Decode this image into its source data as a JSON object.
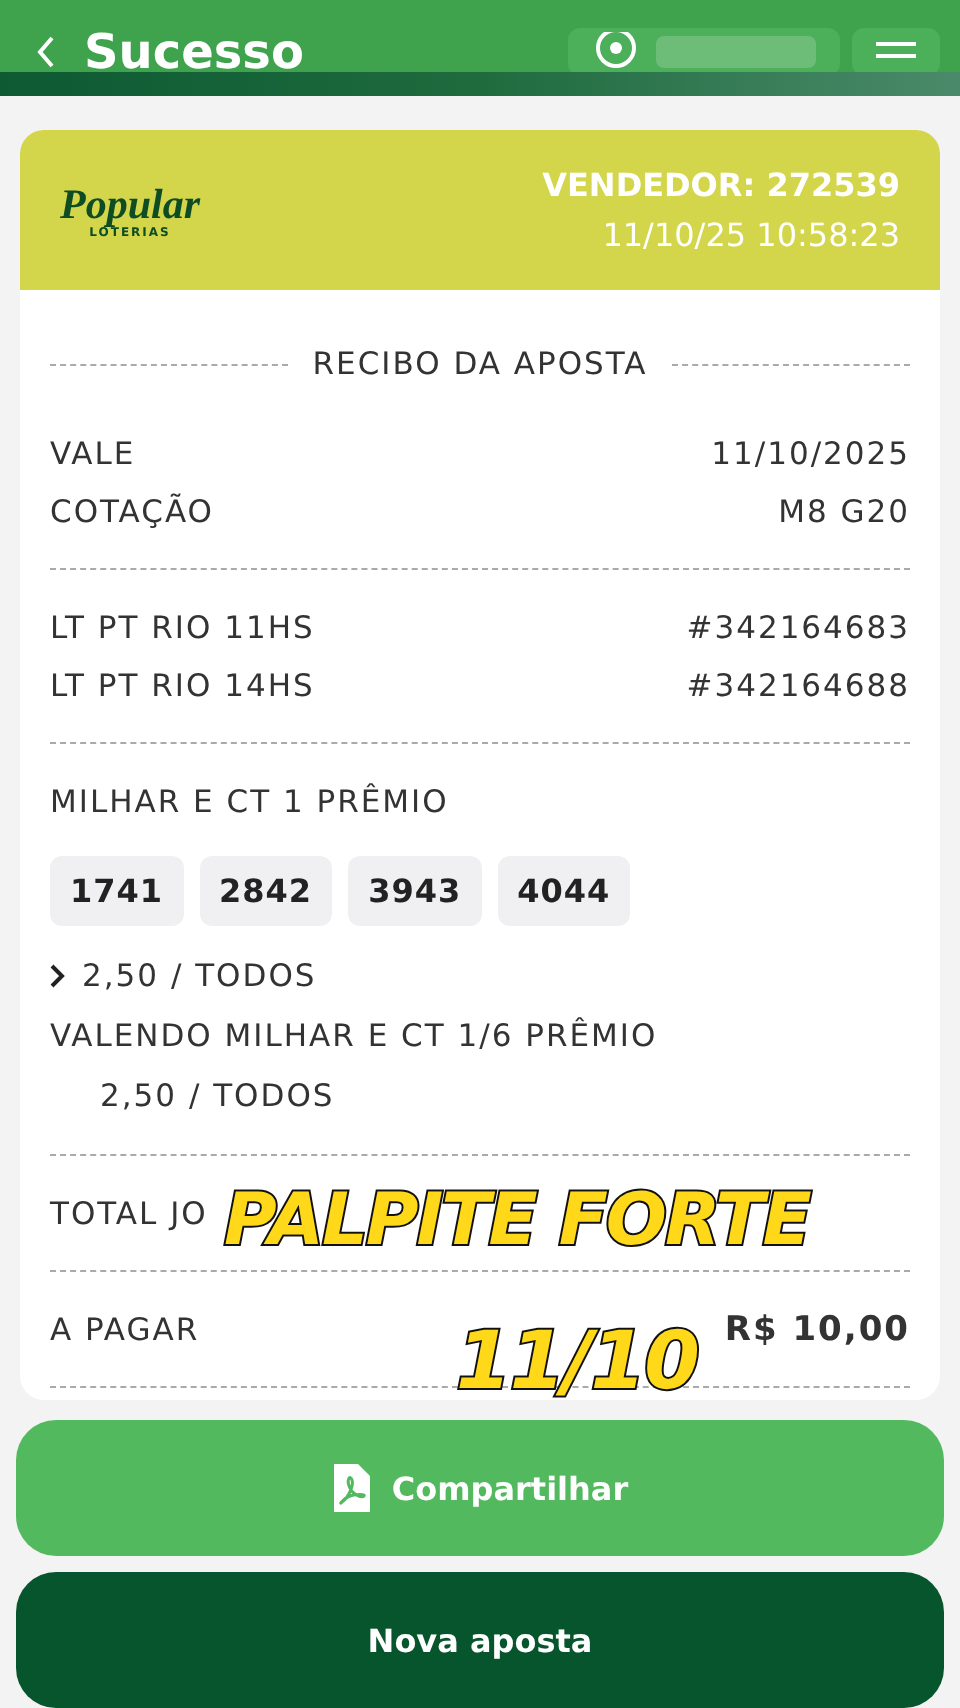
{
  "top_bar": {
    "title": "Sucesso"
  },
  "receipt": {
    "logo": {
      "name": "Popular",
      "sub": "LOTERIAS"
    },
    "vendor": "VENDEDOR: 272539",
    "datetime": "11/10/25 10:58:23",
    "title": "RECIBO DA APOSTA",
    "info": [
      {
        "label": "VALE",
        "value": "11/10/2025"
      },
      {
        "label": "COTAÇÃO",
        "value": "M8 G20"
      }
    ],
    "draws": [
      {
        "label": "LT PT RIO 11HS",
        "value": "#342164683"
      },
      {
        "label": "LT PT RIO 14HS",
        "value": "#342164688"
      }
    ],
    "bet_title": "MILHAR E CT 1 PRÊMIO",
    "numbers": [
      "1741",
      "2842",
      "3943",
      "4044"
    ],
    "details": [
      {
        "kind": "toggle",
        "text": "2,50 / TODOS"
      },
      {
        "kind": "line",
        "text": "VALENDO MILHAR E CT 1/6 PRÊMIO"
      },
      {
        "kind": "indented",
        "text": "2,50 / TODOS"
      }
    ],
    "total_label": "TOTAL JO",
    "pay": {
      "label": "A PAGAR",
      "value": "R$ 10,00"
    }
  },
  "buttons": [
    {
      "kind": "share",
      "label": "Compartilhar"
    },
    {
      "kind": "primary",
      "label": "Nova aposta"
    }
  ],
  "caption": [
    "PALPITE FORTE",
    "11/10"
  ]
}
